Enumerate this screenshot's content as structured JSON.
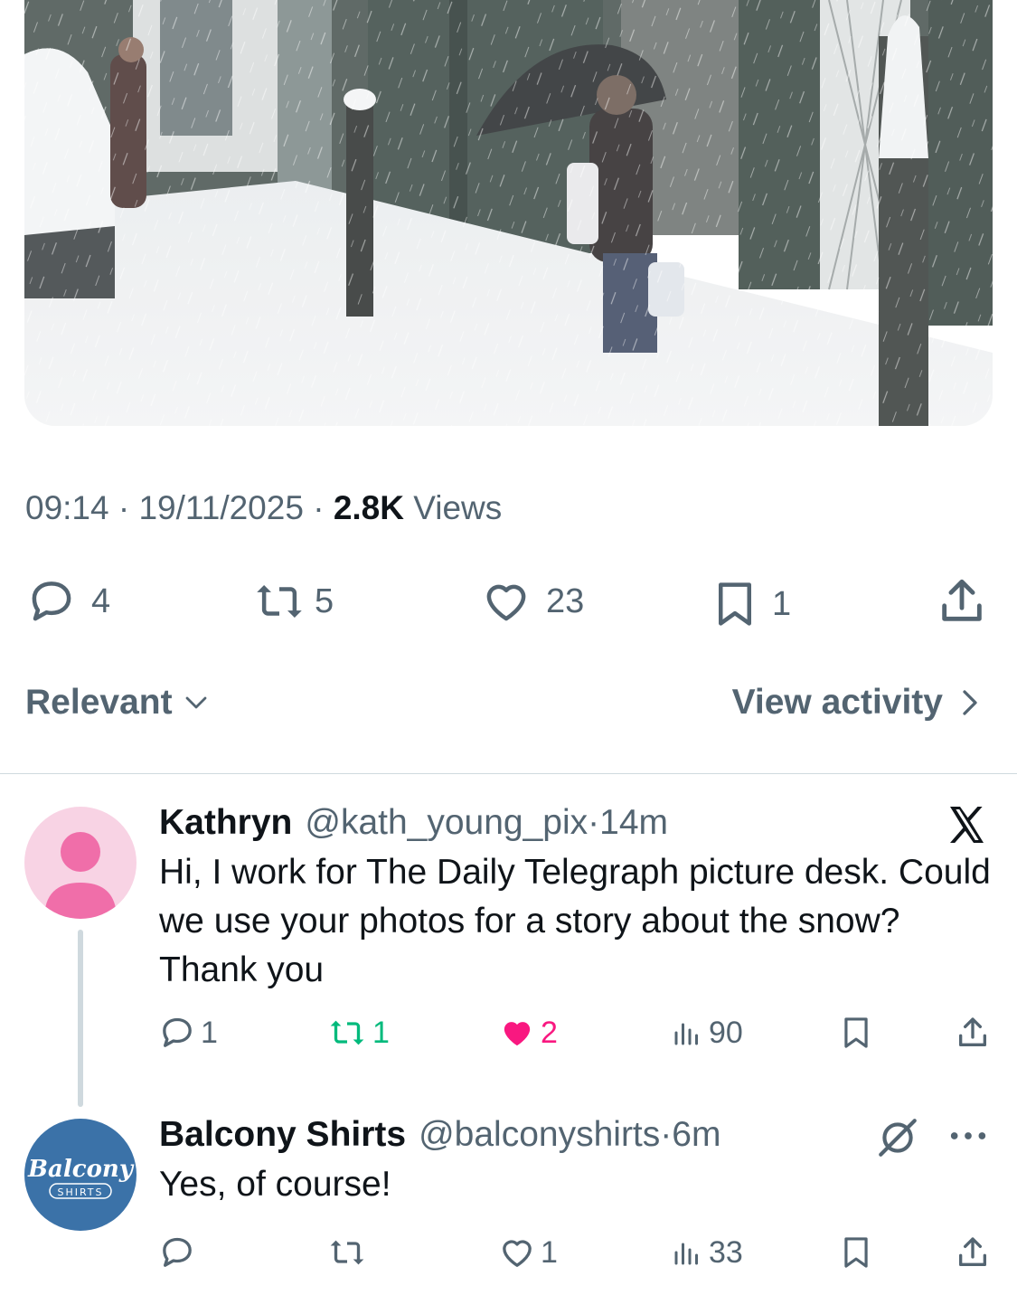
{
  "tweet": {
    "meta": {
      "time": "09:14",
      "sep1": " · ",
      "date": "19/11/2025",
      "sep2": " · ",
      "views_count": "2.8K",
      "views_label": " Views"
    },
    "actions": {
      "replies": "4",
      "reposts": "5",
      "likes": "23",
      "bookmarks": "1"
    }
  },
  "sort": {
    "relevant_label": "Relevant",
    "view_activity_label": "View activity"
  },
  "replies": [
    {
      "name": "Kathryn",
      "handle": "@kath_young_pix",
      "sep": " · ",
      "time": "14m",
      "text": "Hi, I work for The Daily Telegraph picture desk. Could we use your photos for a story about the snow? Thank you",
      "replies": "1",
      "reposts": "1",
      "likes": "2",
      "views": "90",
      "badge_icon": "x-logo-icon"
    },
    {
      "name": "Balcony Shirts",
      "handle": "@balconyshirts",
      "sep": " · ",
      "time": "6m",
      "text": "Yes, of course!",
      "likes": "1",
      "views": "33",
      "avatar_logo_text": "Balcony",
      "avatar_logo_sub": "SHIRTS"
    }
  ],
  "colors": {
    "secondary_text": "#536471",
    "primary_text": "#0f1419",
    "repost_green": "#00ba7c",
    "like_pink": "#f91880",
    "balcony_blue": "#3b72a8"
  }
}
